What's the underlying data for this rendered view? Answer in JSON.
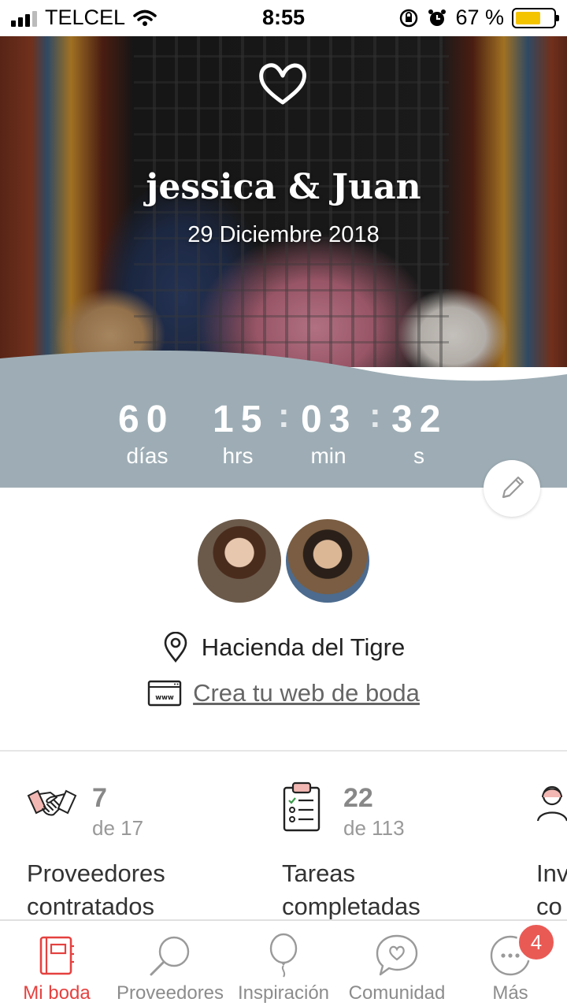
{
  "status_bar": {
    "carrier": "TELCEL",
    "time": "8:55",
    "battery_percent": "67 %",
    "battery_level": 0.67
  },
  "hero": {
    "names": "jessica & Juan",
    "date": "29 Diciembre 2018"
  },
  "countdown": {
    "days": "60",
    "days_label": "días",
    "hours": "15",
    "hours_label": "hrs",
    "minutes": "03",
    "minutes_label": "min",
    "seconds": "32",
    "seconds_label": "s"
  },
  "profile": {
    "venue": "Hacienda del Tigre",
    "web_link": "Crea tu web de boda"
  },
  "stats": [
    {
      "count": "7",
      "total": "de 17",
      "label_line1": "Proveedores",
      "label_line2": "contratados",
      "icon": "handshake-icon"
    },
    {
      "count": "22",
      "total": "de 113",
      "label_line1": "Tareas",
      "label_line2": "completadas",
      "icon": "checklist-icon"
    },
    {
      "count": "",
      "total": "",
      "label_line1": "Inv",
      "label_line2": "co",
      "icon": "guests-icon"
    }
  ],
  "tab_bar": {
    "tabs": [
      {
        "label": "Mi boda",
        "icon": "notebook-icon",
        "active": true
      },
      {
        "label": "Proveedores",
        "icon": "search-icon",
        "active": false
      },
      {
        "label": "Inspiración",
        "icon": "balloon-icon",
        "active": false
      },
      {
        "label": "Comunidad",
        "icon": "chat-heart-icon",
        "active": false
      },
      {
        "label": "Más",
        "icon": "more-icon",
        "active": false
      }
    ],
    "more_badge": "4"
  },
  "colors": {
    "accent": "#e5413f",
    "countdown_band": "#9eadb5",
    "battery": "#f5c400"
  }
}
